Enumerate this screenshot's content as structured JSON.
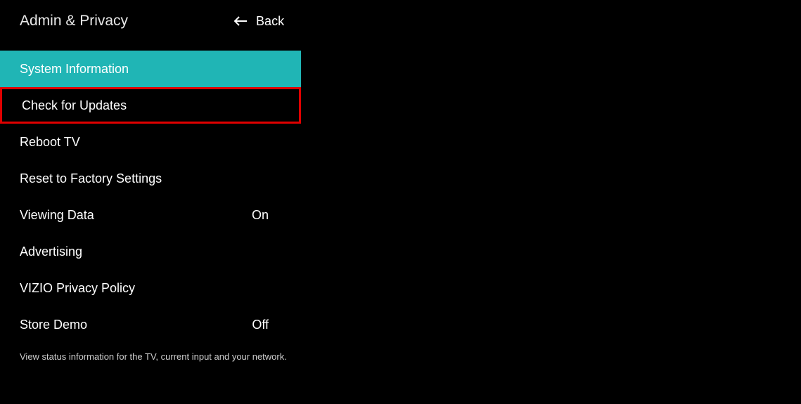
{
  "header": {
    "title": "Admin & Privacy",
    "back_label": "Back"
  },
  "menu": {
    "items": [
      {
        "label": "System Information",
        "value": "",
        "selected": true,
        "highlighted": false
      },
      {
        "label": "Check for Updates",
        "value": "",
        "selected": false,
        "highlighted": true
      },
      {
        "label": "Reboot TV",
        "value": "",
        "selected": false,
        "highlighted": false
      },
      {
        "label": "Reset to Factory Settings",
        "value": "",
        "selected": false,
        "highlighted": false
      },
      {
        "label": "Viewing Data",
        "value": "On",
        "selected": false,
        "highlighted": false
      },
      {
        "label": "Advertising",
        "value": "",
        "selected": false,
        "highlighted": false
      },
      {
        "label": "VIZIO Privacy Policy",
        "value": "",
        "selected": false,
        "highlighted": false
      },
      {
        "label": "Store Demo",
        "value": "Off",
        "selected": false,
        "highlighted": false
      }
    ]
  },
  "footer": {
    "hint": "View status information for the TV, current input and your network."
  }
}
